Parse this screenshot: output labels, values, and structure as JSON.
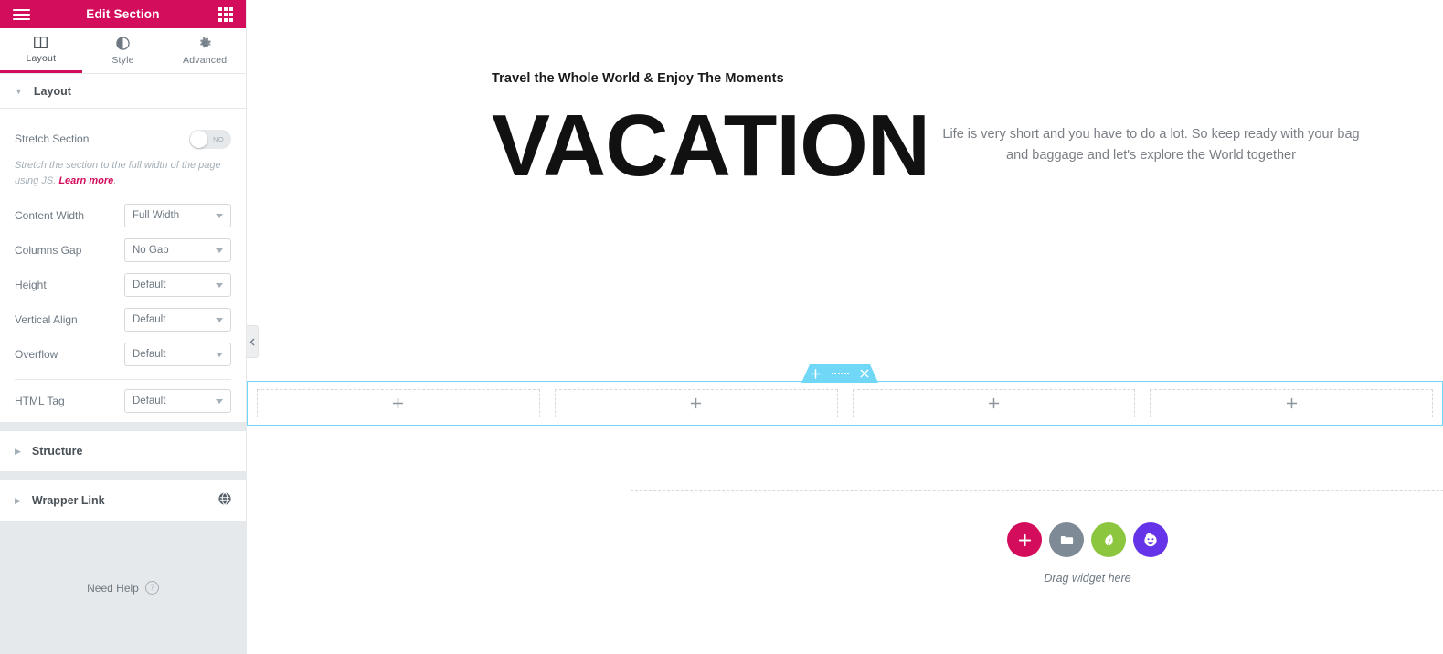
{
  "panel": {
    "header": {
      "title": "Edit Section",
      "menu_icon": "hamburger-icon",
      "apps_icon": "apps-grid-icon",
      "background_color": "#d30c5c"
    },
    "tabs": [
      {
        "label": "Layout",
        "icon": "columns-icon",
        "active": true
      },
      {
        "label": "Style",
        "icon": "contrast-circle-icon",
        "active": false
      },
      {
        "label": "Advanced",
        "icon": "gear-icon",
        "active": false
      }
    ],
    "layout_section": {
      "title": "Layout",
      "caret": "▼"
    },
    "controls": {
      "stretch_section": {
        "label": "Stretch Section",
        "toggle_state": "NO",
        "description_text": "Stretch the section to the full width of the page using JS. ",
        "description_link": "Learn more",
        "description_tail": "."
      },
      "content_width": {
        "label": "Content Width",
        "value": "Full Width"
      },
      "columns_gap": {
        "label": "Columns Gap",
        "value": "No Gap"
      },
      "height": {
        "label": "Height",
        "value": "Default"
      },
      "vertical_align": {
        "label": "Vertical Align",
        "value": "Default"
      },
      "overflow": {
        "label": "Overflow",
        "value": "Default"
      },
      "html_tag": {
        "label": "HTML Tag",
        "value": "Default"
      }
    },
    "accordions": [
      {
        "label": "Structure",
        "caret": "▶",
        "badge_icon": null
      },
      {
        "label": "Wrapper Link",
        "caret": "▶",
        "badge_icon": "pro-globe-icon"
      }
    ],
    "footer": {
      "need_help_label": "Need Help",
      "help_icon": "question-mark-icon"
    }
  },
  "canvas": {
    "collapse_tab_icon": "chevron-left-icon",
    "hero": {
      "kicker": "Travel the Whole World & Enjoy The Moments",
      "title": "VACATION",
      "paragraph": "Life is very short and you have to do a lot. So keep ready with your bag and baggage and let's explore the World together"
    },
    "section": {
      "handle": {
        "add_icon": "plus-icon",
        "drag_icon": "drag-dots-icon",
        "close_icon": "close-x-icon",
        "color": "#71d7f7"
      },
      "columns": [
        {
          "add_icon": "plus-icon"
        },
        {
          "add_icon": "plus-icon"
        },
        {
          "add_icon": "plus-icon"
        },
        {
          "add_icon": "plus-icon"
        }
      ]
    },
    "drop_area": {
      "label": "Drag widget here",
      "buttons": [
        {
          "icon": "plus-icon",
          "color": "#d30c5c"
        },
        {
          "icon": "folder-icon",
          "color": "#7e8a95"
        },
        {
          "icon": "leaf-icon",
          "color": "#8cc63e"
        },
        {
          "icon": "happy-face-icon",
          "color": "#6533e8"
        }
      ]
    }
  }
}
